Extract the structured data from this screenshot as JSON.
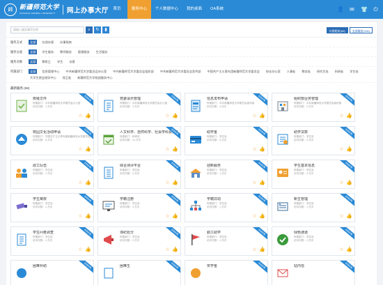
{
  "header": {
    "school_cn": "新疆师范大学",
    "school_en": "XINJIANG NORMAL UNIVERSITY",
    "hall_title": "网上办事大厅",
    "nav": [
      {
        "label": "首页",
        "active": false
      },
      {
        "label": "服务中心",
        "active": true
      },
      {
        "label": "个人数据中心",
        "active": false
      },
      {
        "label": "我的桌面",
        "active": false
      },
      {
        "label": "OA系统",
        "active": false
      }
    ]
  },
  "search": {
    "placeholder": "请输入服务事项名称",
    "btn_mine": "与我相关(69)",
    "btn_all": "全部服务(106)"
  },
  "filters": [
    {
      "label": "服务方式",
      "options": [
        "全部",
        "在线办理",
        "办事指南"
      ]
    },
    {
      "label": "服务分类",
      "options": [
        "全部",
        "学生服务",
        "教师服务",
        "管理服务",
        "生活服务"
      ]
    },
    {
      "label": "服务对象",
      "options": [
        "全部",
        "教职工",
        "学生",
        "访客"
      ]
    },
    {
      "label": "所属部门",
      "options": [
        "全部",
        "信息管理中心",
        "中共新疆师范大学委员会办公室",
        "中共新疆师范大学委员会组织部",
        "中共新疆师范大学委员会宣传部",
        "中国共产主义青年团新疆师范大学委员会",
        "校长办公室",
        "人事处",
        "教务处",
        "研究生处",
        "科研处",
        "学生处",
        "大学生就业指导中心",
        "保卫处",
        "新疆师范大学校园服务中心"
      ]
    }
  ],
  "section_title": "最新服务 (69)",
  "cards": [
    {
      "name": "校级文件",
      "dept": "所属部门：中共新疆师范大学委员会办公室",
      "visits": "访问次数：1.万次",
      "icon": "document-check-icon"
    },
    {
      "name": "党委请示管理",
      "dept": "所属部门：中共新疆师范大学委员会办公室",
      "visits": "访问次数：3.万次",
      "icon": "list-document-icon"
    },
    {
      "name": "信息发布申请",
      "dept": "所属部门：中共新疆师范大学委员会宣传部",
      "visits": "访问次数：4.万次",
      "icon": "info-doc-icon"
    },
    {
      "name": "组织部业务管理",
      "dept": "所属部门：中共新疆师范大学委员会组织部",
      "visits": "访问次数：2.万次",
      "icon": "building-doc-icon"
    },
    {
      "name": "校园文化活动申请",
      "dept": "所属部门：中国共产主义青年团新疆师范大学委员会",
      "visits": "访问次数：8.万次",
      "icon": "campus-activity-icon"
    },
    {
      "name": "人文科学、自然科学、社会学科会议申请",
      "dept": "所属部门：科研处",
      "visits": "访问次数：12.万次",
      "icon": "calendar-check-icon"
    },
    {
      "name": "助学金",
      "dept": "所属部门：学生处",
      "visits": "访问次数：5.万次",
      "icon": "card-icon"
    },
    {
      "name": "助学贷款",
      "dept": "所属部门：学生处",
      "visits": "访问次数：3.万次",
      "icon": "loan-icon"
    },
    {
      "name": "政工队伍",
      "dept": "所属部门：学生处",
      "visits": "访问次数：1.万次",
      "icon": "team-icon"
    },
    {
      "name": "综合测评平台",
      "dept": "所属部门：学生处",
      "visits": "访问次数：3.万次",
      "icon": "report-icon"
    },
    {
      "name": "迎新服务",
      "dept": "所属部门：学生处",
      "visits": "访问次数：1.万次",
      "icon": "welcome-building-icon"
    },
    {
      "name": "学生基本信息",
      "dept": "所属部门：学生处",
      "visits": "访问次数：2.万次",
      "icon": "student-info-icon"
    },
    {
      "name": "学生离校",
      "dept": "所属部门：学生处",
      "visits": "访问次数：1.万次",
      "icon": "camera-icon"
    },
    {
      "name": "学籍注册",
      "dept": "所属部门：学生处",
      "visits": "访问次数：3.万次",
      "icon": "monitor-icon"
    },
    {
      "name": "学籍异动",
      "dept": "所属部门：学生处",
      "visits": "访问次数：1.万次",
      "icon": "network-icon"
    },
    {
      "name": "新生管理",
      "dept": "所属部门：学生处",
      "visits": "访问次数：1.万次",
      "icon": "new-student-icon"
    },
    {
      "name": "学生问卷调查",
      "dept": "所属部门：学生处",
      "visits": "访问次数：1.万次",
      "icon": "survey-icon"
    },
    {
      "name": "违纪处分",
      "dept": "所属部门：学生处",
      "visits": "访问次数：2.万次",
      "icon": "megaphone-icon"
    },
    {
      "name": "勤工助学",
      "dept": "所属部门：学生处",
      "visits": "访问次数：1.万次",
      "icon": "flag-icon"
    },
    {
      "name": "绿色通道",
      "dept": "所属部门：学生处",
      "visits": "访问次数：1.万次",
      "icon": "green-channel-icon"
    },
    {
      "name": "困难补助",
      "dept": "",
      "visits": "",
      "icon": "subsidy-icon"
    },
    {
      "name": "困难生",
      "dept": "",
      "visits": "",
      "icon": "needy-student-icon"
    },
    {
      "name": "奖学金",
      "dept": "",
      "visits": "",
      "icon": "scholarship-icon"
    },
    {
      "name": "站内信",
      "dept": "",
      "visits": "",
      "icon": "mail-icon"
    }
  ],
  "ribbon_label": "在线办理",
  "colors": {
    "header": "#2a8ad6",
    "active_nav": "#f0a030",
    "accent": "#2a6cb5",
    "action": "#f0a030"
  }
}
